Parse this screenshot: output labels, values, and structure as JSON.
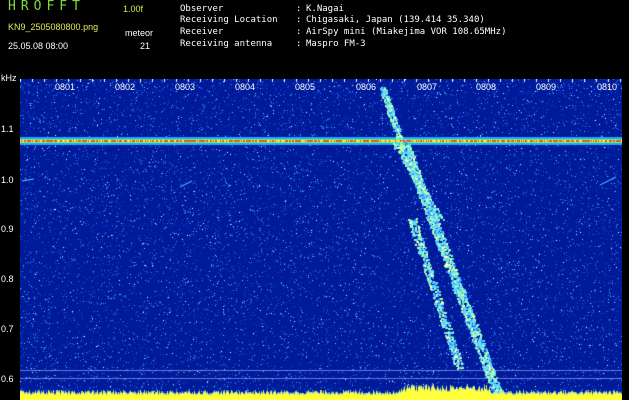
{
  "header": {
    "app_title": "HROFFT",
    "version": "1.00f",
    "filename": "KN9_2505080800.png",
    "object_label": "meteor",
    "datetime": "25.05.08 08:00",
    "object_count": "21",
    "fields": [
      {
        "key": "Observer",
        "sep": ":",
        "value": "K.Nagai"
      },
      {
        "key": "Receiving Location",
        "sep": ":",
        "value": "Chigasaki, Japan (139.414 35.340)"
      },
      {
        "key": "Receiver",
        "sep": ":",
        "value": "AirSpy mini (Miakejima VOR 108.65MHz)"
      },
      {
        "key": "Receiving antenna",
        "sep": ":",
        "value": "Maspro FM-3"
      }
    ]
  },
  "spectrogram": {
    "y_unit": "kHz",
    "x_ticks": [
      "0801",
      "0802",
      "0803",
      "0804",
      "0805",
      "0806",
      "0807",
      "0808",
      "0809",
      "0810"
    ],
    "y_ticks": [
      "1.1",
      "1.0",
      "0.9",
      "0.8",
      "0.7",
      "0.6"
    ],
    "colors": {
      "background": "#001a9a",
      "carrier": "#ff4a1a",
      "meteor": "#5fd7ff",
      "noise_floor": "#ffff3a"
    }
  }
}
